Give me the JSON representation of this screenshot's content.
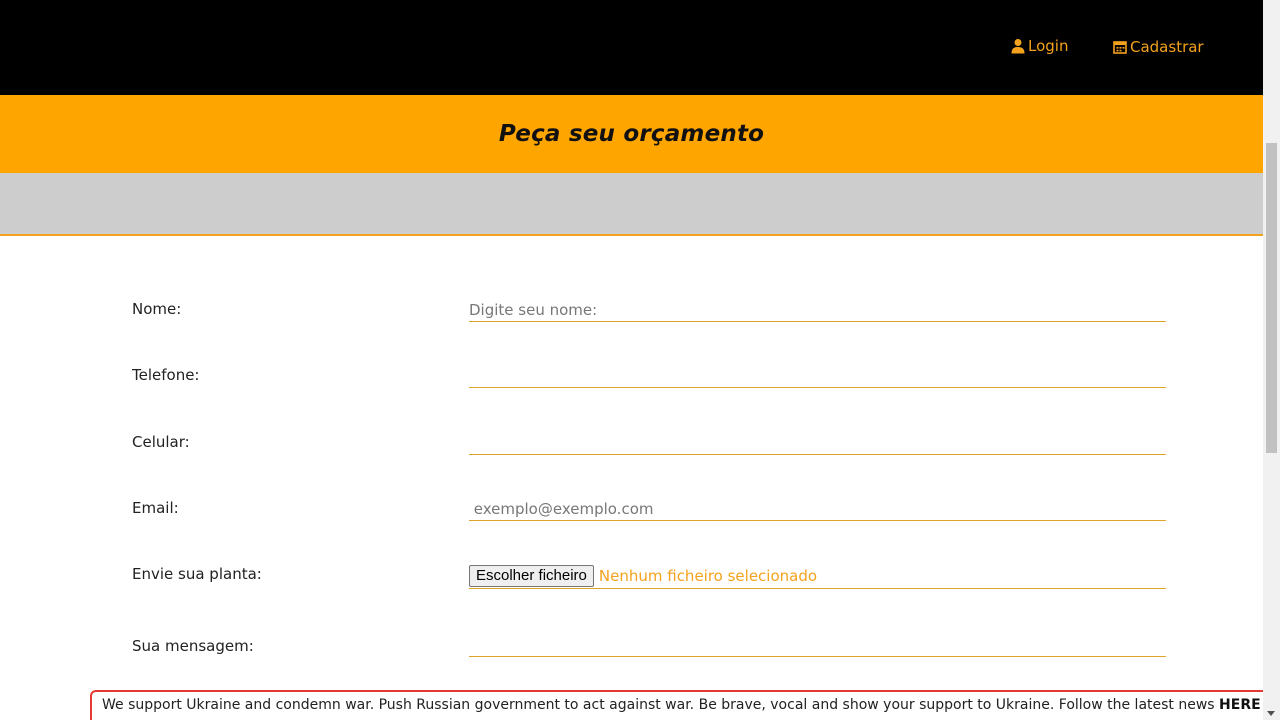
{
  "nav": {
    "login_label": "Login",
    "cadastrar_label": "Cadastrar"
  },
  "banner": {
    "title": "Peça seu orçamento"
  },
  "form": {
    "nome_label": "Nome:",
    "nome_placeholder": "Digite seu nome:",
    "telefone_label": "Telefone:",
    "celular_label": "Celular:",
    "email_label": "Email:",
    "email_placeholder": " exemplo@exemplo.com",
    "planta_label": "Envie sua planta:",
    "file_button_label": "Escolher ficheiro",
    "file_status": "Nenhum ficheiro selecionado",
    "mensagem_label": "Sua mensagem:"
  },
  "notice": {
    "text": "We support Ukraine and condemn war. Push Russian government to act against war. Be brave, vocal and show your support to Ukraine. Follow the latest news ",
    "link_label": "HERE"
  },
  "colors": {
    "accent": "#ffa500",
    "link": "#f4a21d",
    "header_bg": "#000000",
    "band_bg": "#cdcdcd",
    "notice_border": "#e53935"
  },
  "icons": {
    "login": "user-icon",
    "cadastrar": "calendar-icon"
  }
}
